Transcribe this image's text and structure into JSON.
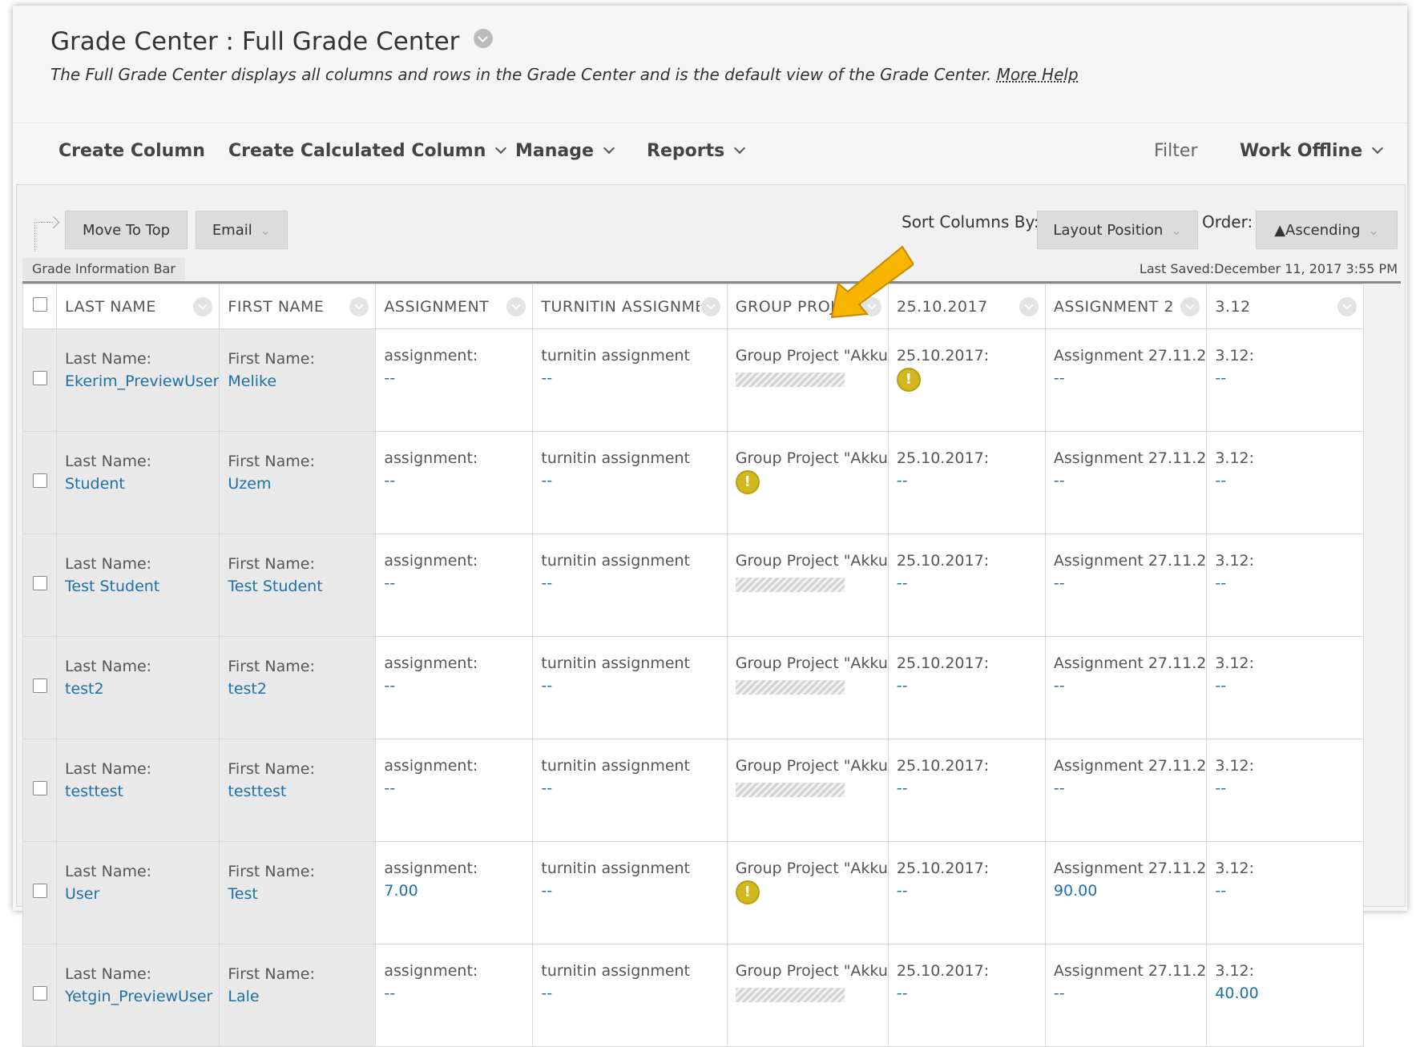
{
  "page": {
    "title": "Grade Center : Full Grade Center",
    "description": "The Full Grade Center displays all columns and rows in the Grade Center and is the default view of the Grade Center.",
    "more_help": "More Help"
  },
  "toolbar": {
    "create_column": "Create Column",
    "create_calculated_column": "Create Calculated Column",
    "manage": "Manage",
    "reports": "Reports",
    "filter": "Filter",
    "work_offline": "Work Offline"
  },
  "actions": {
    "move_to_top": "Move To Top",
    "email": "Email",
    "sort_label": "Sort Columns By:",
    "sort_value": "Layout Position",
    "order_label": "Order:",
    "order_value": "▲Ascending"
  },
  "info_bar": {
    "tab": "Grade Information Bar",
    "last_saved": "Last Saved:December 11, 2017 3:55 PM"
  },
  "columns": [
    "LAST NAME",
    "FIRST NAME",
    "ASSIGNMENT",
    "TURNITIN ASSIGNMENT",
    "GROUP PROJECT",
    "25.10.2017",
    "ASSIGNMENT 2",
    "3.12"
  ],
  "cell_labels": {
    "last": "Last Name:",
    "first": "First Name:",
    "assignment": "assignment:",
    "turnitin": "turnitin assignment",
    "group": "Group Project \"Akku",
    "date": "25.10.2017:",
    "assignment2": "Assignment 27.11.2",
    "col312": "3.12:"
  },
  "rows": [
    {
      "last": "Ekerim_PreviewUser",
      "first": "Melike",
      "assignment": "--",
      "turnitin": "--",
      "group": "hatch",
      "date": "warn",
      "assignment2": "--",
      "col312": "--"
    },
    {
      "last": "Student",
      "first": "Uzem",
      "assignment": "--",
      "turnitin": "--",
      "group": "warn",
      "date": "--",
      "assignment2": "--",
      "col312": "--"
    },
    {
      "last": "Test Student",
      "first": "Test Student",
      "assignment": "--",
      "turnitin": "--",
      "group": "hatch",
      "date": "--",
      "assignment2": "--",
      "col312": "--"
    },
    {
      "last": "test2",
      "first": "test2",
      "assignment": "--",
      "turnitin": "--",
      "group": "hatch",
      "date": "--",
      "assignment2": "--",
      "col312": "--"
    },
    {
      "last": "testtest",
      "first": "testtest",
      "assignment": "--",
      "turnitin": "--",
      "group": "hatch",
      "date": "--",
      "assignment2": "--",
      "col312": "--"
    },
    {
      "last": "User",
      "first": "Test",
      "assignment": "7.00",
      "turnitin": "--",
      "group": "warn",
      "date": "--",
      "assignment2": "90.00",
      "col312": "--"
    },
    {
      "last": "Yetgin_PreviewUser",
      "first": "Lale",
      "assignment": "--",
      "turnitin": "--",
      "group": "hatch",
      "date": "--",
      "assignment2": "--",
      "col312": "40.00"
    }
  ],
  "colors": {
    "link": "#1f6fa8",
    "warning": "#d2b820",
    "pointer": "#f7b500"
  },
  "icons": {
    "warning": "!"
  }
}
